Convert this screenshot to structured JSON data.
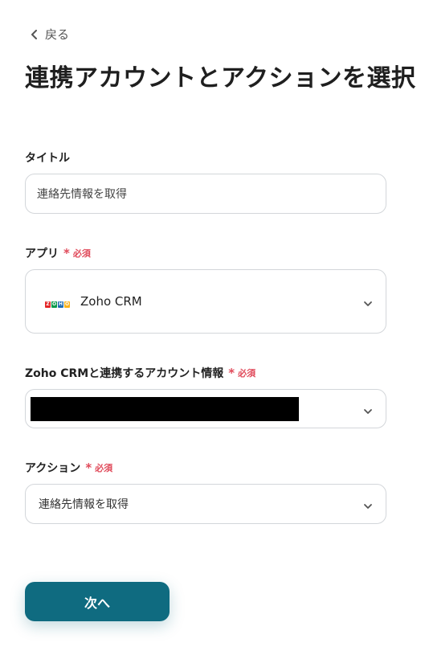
{
  "back": {
    "label": "戻る"
  },
  "page_title": "連携アカウントとアクションを選択",
  "title_field": {
    "label": "タイトル",
    "value": "連絡先情報を取得"
  },
  "app_field": {
    "label": "アプリ",
    "required_mark": "*",
    "required_text": "必須",
    "selected_app": "Zoho CRM",
    "logo_letters": [
      "Z",
      "O",
      "H",
      "O"
    ],
    "logo_colors": [
      "#e42527",
      "#089949",
      "#226db4",
      "#f9b21d"
    ]
  },
  "account_field": {
    "label": "Zoho CRMと連携するアカウント情報",
    "required_mark": "*",
    "required_text": "必須"
  },
  "action_field": {
    "label": "アクション",
    "required_mark": "*",
    "required_text": "必須",
    "selected_action": "連絡先情報を取得"
  },
  "next_button": {
    "label": "次へ"
  },
  "colors": {
    "primary": "#0f6b80",
    "required": "#e04a5a",
    "border": "#d3d6da"
  }
}
